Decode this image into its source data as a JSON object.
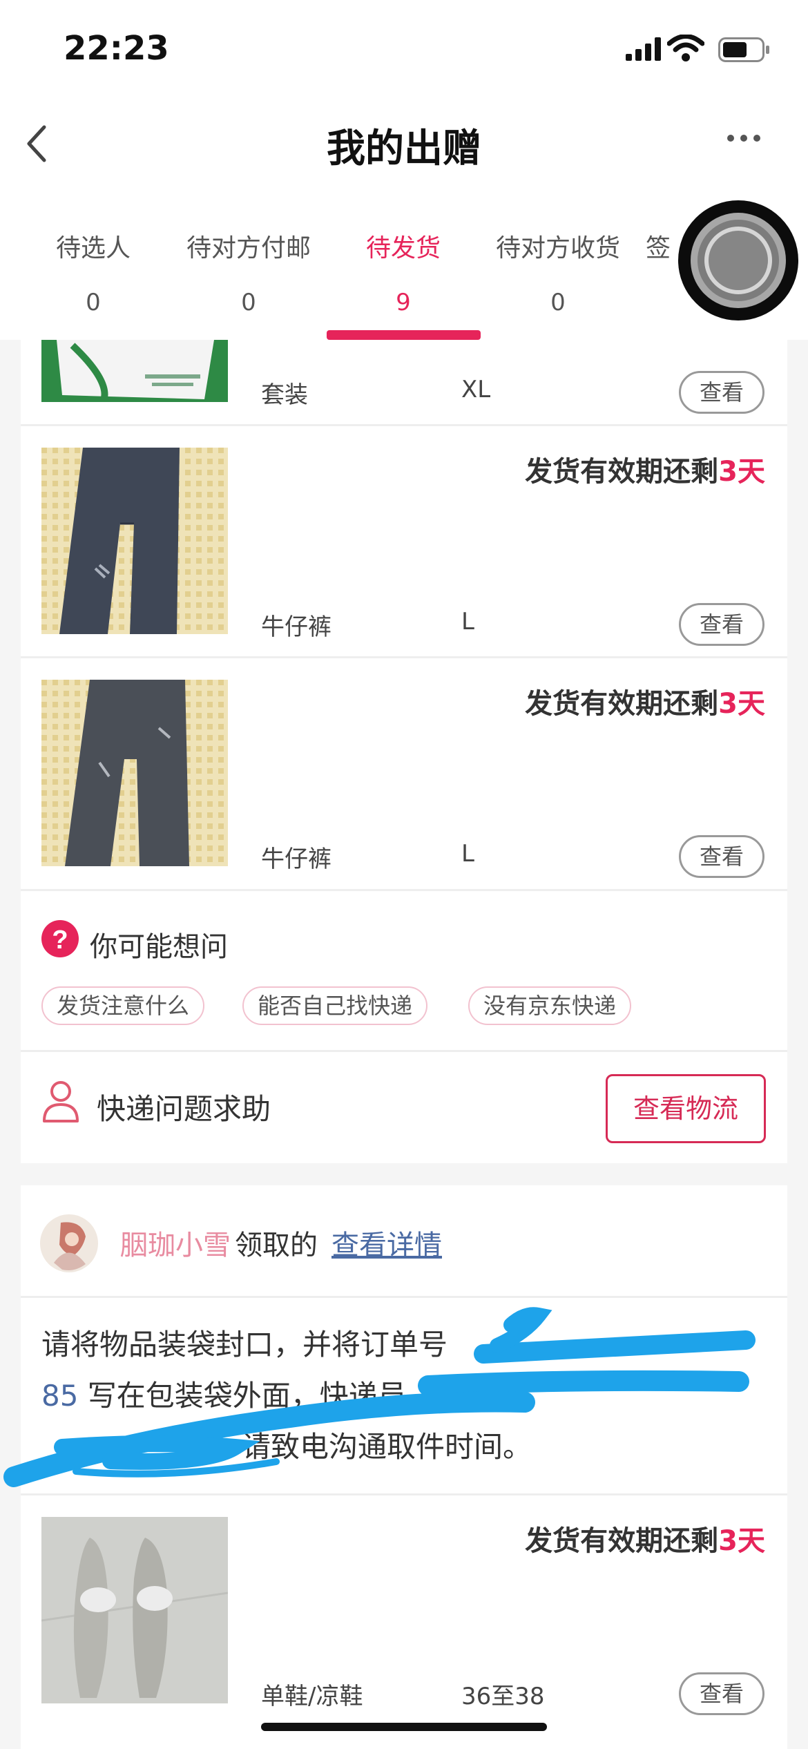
{
  "status_bar": {
    "time": "22:23"
  },
  "nav": {
    "title": "我的出赠"
  },
  "tabs": [
    {
      "label": "待选人",
      "count": "0"
    },
    {
      "label": "待对方付邮",
      "count": "0"
    },
    {
      "label": "待发货",
      "count": "9"
    },
    {
      "label": "待对方收货",
      "count": "0"
    },
    {
      "label": "签",
      "count": ""
    }
  ],
  "items": [
    {
      "name": "套装",
      "size": "XL",
      "view": "查看"
    },
    {
      "deadline_prefix": "发货有效期还剩",
      "deadline_days": "3天",
      "name": "牛仔裤",
      "size": "L",
      "view": "查看"
    },
    {
      "deadline_prefix": "发货有效期还剩",
      "deadline_days": "3天",
      "name": "牛仔裤",
      "size": "L",
      "view": "查看"
    }
  ],
  "faq": {
    "title": "你可能想问",
    "chips": [
      "发货注意什么",
      "能否自己找快递",
      "没有京东快递"
    ]
  },
  "courier": {
    "help_label": "快递问题求助",
    "track_button": "查看物流"
  },
  "order2": {
    "user": "胭珈小雪",
    "claimed": "领取的",
    "detail_link": "查看详情",
    "notice_part1": "请将物品装袋封口，并将订单号",
    "order_tail": "85",
    "notice_part2": " 写在包装袋外面，快递员",
    "notice_part3": "请致电沟通取件时间。",
    "item": {
      "deadline_prefix": "发货有效期还剩",
      "deadline_days": "3天",
      "name": "单鞋/凉鞋",
      "size": "36至38",
      "view": "查看"
    }
  }
}
